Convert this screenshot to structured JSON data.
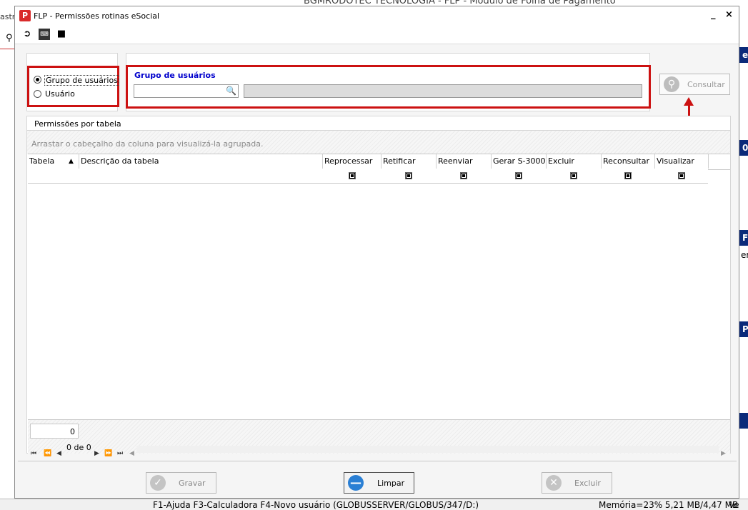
{
  "background": {
    "window_title": "BGMRODOTEC TECNOLOGIA - FLP - Módulo de Folha de Pagamento",
    "left_text": "astr",
    "right_labels": [
      "e",
      "0",
      "Fe",
      "er",
      "P"
    ]
  },
  "dialog": {
    "title": "FLP - Permissões rotinas eSocial",
    "minimize": "_",
    "close": "×"
  },
  "filter": {
    "options": [
      "Grupo de usuários",
      "Usuário"
    ],
    "selected": "Grupo de usuários",
    "group_label": "Grupo de usuários",
    "search_value": "",
    "description_value": ""
  },
  "consult_button": "Consultar",
  "grid": {
    "section_title": "Permissões por tabela",
    "group_hint": "Arrastar o cabeçalho da coluna para visualizá-la agrupada.",
    "columns": [
      "Tabela",
      "Descrição da tabela",
      "Reprocessar",
      "Retificar",
      "Reenviar",
      "Gerar S-3000",
      "Excluir",
      "Reconsultar",
      "Visualizar"
    ],
    "sort_column": "Tabela",
    "filter_row_checked": [
      true,
      true,
      true,
      true,
      true,
      true,
      true
    ],
    "footer_count": "0",
    "pager_text": "0 de 0"
  },
  "actions": {
    "save": "Gravar",
    "clear": "Limpar",
    "delete": "Excluir"
  },
  "statusbar": {
    "shortcuts": "F1-Ajuda F3-Calculadora F4-Novo usuário (GLOBUSSERVER/GLOBUS/347/D:)",
    "memory": "Memória=23% 5,21 MB/4,47 MB",
    "version": "Ve"
  },
  "colors": {
    "annotation_red": "#cc1111",
    "group_label_blue": "#0000cc",
    "clear_icon_blue": "#2a7fd4"
  }
}
